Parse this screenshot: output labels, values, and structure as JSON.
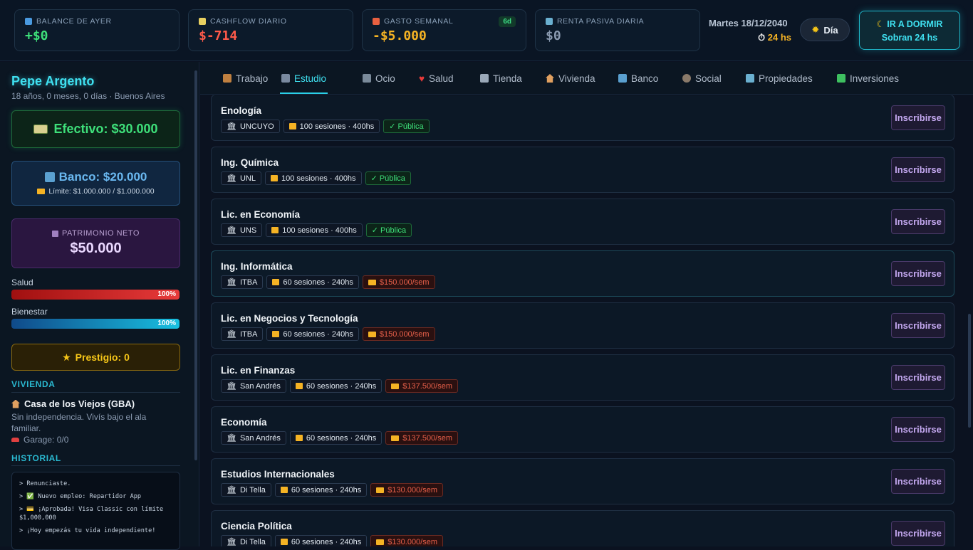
{
  "header": {
    "stats": [
      {
        "label": "BALANCE DE AYER",
        "value": "+$0",
        "color": "#3ee07a",
        "icon": "balance-icon"
      },
      {
        "label": "CASHFLOW DIARIO",
        "value": "$-714",
        "color": "#ff5a4a",
        "icon": "cashflow-icon"
      },
      {
        "label": "GASTO SEMANAL",
        "value": "-$5.000",
        "color": "#f5b324",
        "badge": "6d",
        "icon": "calendar-icon"
      },
      {
        "label": "RENTA PASIVA DIARIA",
        "value": "$0",
        "color": "#8a9ab0",
        "icon": "building-icon"
      }
    ],
    "date": "Martes 18/12/2040",
    "hours_left": "24 hs",
    "day_button": "Día",
    "sleep_button": {
      "line1": "IR A DORMIR",
      "line2": "Sobran 24 hs"
    }
  },
  "sidebar": {
    "name": "Pepe Argento",
    "age": "18 años, 0 meses, 0 días · Buenos Aires",
    "cash": "Efectivo: $30.000",
    "bank": {
      "title": "Banco: $20.000",
      "limit": "Límite: $1.000.000 / $1.000.000"
    },
    "networth": {
      "label": "PATRIMONIO NETO",
      "value": "$50.000"
    },
    "health": {
      "label": "Salud",
      "pct": "100%",
      "level": 1.0
    },
    "wellbeing": {
      "label": "Bienestar",
      "pct": "100%",
      "level": 1.0
    },
    "prestige": "Prestigio: 0",
    "housing": {
      "section": "VIVIENDA",
      "name": "Casa de los Viejos (GBA)",
      "desc": "Sin independencia. Vivís bajo el ala familiar.",
      "garage": "Garage: 0/0"
    },
    "history": {
      "section": "HISTORIAL",
      "items": [
        "> Renunciaste.",
        "> ✅ Nuevo empleo: Repartidor App",
        "> 💳 ¡Aprobada! Visa Classic con límite $1,000,000",
        "> ¡Hoy empezás tu vida independiente!"
      ]
    }
  },
  "tabs": [
    {
      "label": "Trabajo",
      "icon": "briefcase-icon",
      "color": "#c08040"
    },
    {
      "label": "Estudio",
      "icon": "graduation-cap-icon",
      "color": "#8a9ab0",
      "active": true
    },
    {
      "label": "Ocio",
      "icon": "gamepad-icon",
      "color": "#7a8a9a"
    },
    {
      "label": "Salud",
      "icon": "heart-icon",
      "color": "#e83a3a"
    },
    {
      "label": "Tienda",
      "icon": "cart-icon",
      "color": "#9aa8b8"
    },
    {
      "label": "Vivienda",
      "icon": "house-icon",
      "color": "#e0a060"
    },
    {
      "label": "Banco",
      "icon": "bank-icon",
      "color": "#5aa0d0"
    },
    {
      "label": "Social",
      "icon": "people-icon",
      "color": "#8a7a6a"
    },
    {
      "label": "Propiedades",
      "icon": "building-icon",
      "color": "#6ab0d0"
    },
    {
      "label": "Inversiones",
      "icon": "chart-icon",
      "color": "#3ec060"
    }
  ],
  "courses": [
    {
      "title": "Enología",
      "inst": "UNCUYO",
      "sessions": "100 sesiones · 400hs",
      "cost": "✓ Pública",
      "type": "pub"
    },
    {
      "title": "Ing. Química",
      "inst": "UNL",
      "sessions": "100 sesiones · 400hs",
      "cost": "✓ Pública",
      "type": "pub"
    },
    {
      "title": "Lic. en Economía",
      "inst": "UNS",
      "sessions": "100 sesiones · 400hs",
      "cost": "✓ Pública",
      "type": "pub"
    },
    {
      "title": "Ing. Informática",
      "inst": "ITBA",
      "sessions": "60 sesiones · 240hs",
      "cost": "$150.000/sem",
      "type": "price"
    },
    {
      "title": "Lic. en Negocios y Tecnología",
      "inst": "ITBA",
      "sessions": "60 sesiones · 240hs",
      "cost": "$150.000/sem",
      "type": "price"
    },
    {
      "title": "Lic. en Finanzas",
      "inst": "San Andrés",
      "sessions": "60 sesiones · 240hs",
      "cost": "$137.500/sem",
      "type": "price"
    },
    {
      "title": "Economía",
      "inst": "San Andrés",
      "sessions": "60 sesiones · 240hs",
      "cost": "$137.500/sem",
      "type": "price"
    },
    {
      "title": "Estudios Internacionales",
      "inst": "Di Tella",
      "sessions": "60 sesiones · 240hs",
      "cost": "$130.000/sem",
      "type": "price"
    },
    {
      "title": "Ciencia Política",
      "inst": "Di Tella",
      "sessions": "60 sesiones · 240hs",
      "cost": "$130.000/sem",
      "type": "price"
    }
  ],
  "enroll_label": "Inscribirse"
}
